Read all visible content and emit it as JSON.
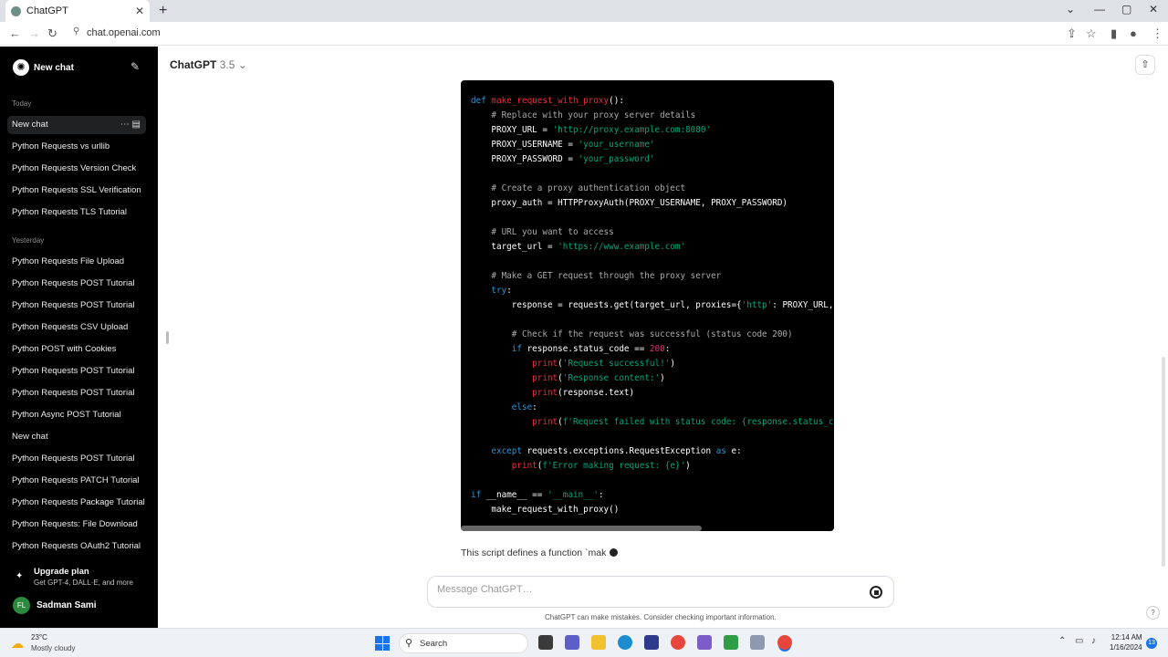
{
  "browser": {
    "tab_title": "ChatGPT",
    "url": "chat.openai.com"
  },
  "sidebar": {
    "new_chat_label": "New chat",
    "sections": [
      {
        "heading": "Today",
        "items": [
          {
            "label": "New chat",
            "active": true
          },
          {
            "label": "Python Requests vs urllib"
          },
          {
            "label": "Python Requests Version Check"
          },
          {
            "label": "Python Requests SSL Verification"
          },
          {
            "label": "Python Requests TLS Tutorial"
          }
        ]
      },
      {
        "heading": "Yesterday",
        "items": [
          {
            "label": "Python Requests File Upload"
          },
          {
            "label": "Python Requests POST Tutorial"
          },
          {
            "label": "Python Requests POST Tutorial"
          },
          {
            "label": "Python Requests CSV Upload"
          },
          {
            "label": "Python POST with Cookies"
          },
          {
            "label": "Python Requests POST Tutorial"
          },
          {
            "label": "Python Requests POST Tutorial"
          },
          {
            "label": "Python Async POST Tutorial"
          },
          {
            "label": "New chat"
          },
          {
            "label": "Python Requests POST Tutorial"
          },
          {
            "label": "Python Requests PATCH Tutorial"
          },
          {
            "label": "Python Requests Package Tutorial"
          },
          {
            "label": "Python Requests: File Download"
          },
          {
            "label": "Python Requests OAuth2 Tutorial"
          }
        ]
      }
    ],
    "upgrade": {
      "title": "Upgrade plan",
      "subtitle": "Get GPT-4, DALL·E, and more"
    },
    "user": {
      "initials": "FL",
      "name": "Sadman Sami"
    }
  },
  "header": {
    "model": "ChatGPT",
    "version": "3.5"
  },
  "code_lines": [
    [
      {
        "t": "def ",
        "c": "kw"
      },
      {
        "t": "make_request_with_proxy",
        "c": "fn"
      },
      {
        "t": "():"
      }
    ],
    [
      {
        "t": "    "
      },
      {
        "t": "# Replace with your proxy server details",
        "c": "cm"
      }
    ],
    [
      {
        "t": "    PROXY_URL = "
      },
      {
        "t": "'http://proxy.example.com:8080'",
        "c": "str"
      }
    ],
    [
      {
        "t": "    PROXY_USERNAME = "
      },
      {
        "t": "'your_username'",
        "c": "str"
      }
    ],
    [
      {
        "t": "    PROXY_PASSWORD = "
      },
      {
        "t": "'your_password'",
        "c": "str"
      }
    ],
    [],
    [
      {
        "t": "    "
      },
      {
        "t": "# Create a proxy authentication object",
        "c": "cm"
      }
    ],
    [
      {
        "t": "    proxy_auth = HTTPProxyAuth(PROXY_USERNAME, PROXY_PASSWORD)"
      }
    ],
    [],
    [
      {
        "t": "    "
      },
      {
        "t": "# URL you want to access",
        "c": "cm"
      }
    ],
    [
      {
        "t": "    target_url = "
      },
      {
        "t": "'https://www.example.com'",
        "c": "str"
      }
    ],
    [],
    [
      {
        "t": "    "
      },
      {
        "t": "# Make a GET request through the proxy server",
        "c": "cm"
      }
    ],
    [
      {
        "t": "    "
      },
      {
        "t": "try",
        "c": "kw"
      },
      {
        "t": ":"
      }
    ],
    [
      {
        "t": "        response = requests.get(target_url, proxies={"
      },
      {
        "t": "'http'",
        "c": "str"
      },
      {
        "t": ": PROXY_URL,"
      }
    ],
    [],
    [
      {
        "t": "        "
      },
      {
        "t": "# Check if the request was successful (status code 200)",
        "c": "cm"
      }
    ],
    [
      {
        "t": "        "
      },
      {
        "t": "if",
        "c": "kw"
      },
      {
        "t": " response.status_code == "
      },
      {
        "t": "200",
        "c": "num"
      },
      {
        "t": ":"
      }
    ],
    [
      {
        "t": "            "
      },
      {
        "t": "print",
        "c": "fn"
      },
      {
        "t": "("
      },
      {
        "t": "'Request successful!'",
        "c": "str"
      },
      {
        "t": ")"
      }
    ],
    [
      {
        "t": "            "
      },
      {
        "t": "print",
        "c": "fn"
      },
      {
        "t": "("
      },
      {
        "t": "'Response content:'",
        "c": "str"
      },
      {
        "t": ")"
      }
    ],
    [
      {
        "t": "            "
      },
      {
        "t": "print",
        "c": "fn"
      },
      {
        "t": "(response.text)"
      }
    ],
    [
      {
        "t": "        "
      },
      {
        "t": "else",
        "c": "kw"
      },
      {
        "t": ":"
      }
    ],
    [
      {
        "t": "            "
      },
      {
        "t": "print",
        "c": "fn"
      },
      {
        "t": "("
      },
      {
        "t": "f'Request failed with status code: {response.status_c",
        "c": "str"
      }
    ],
    [],
    [
      {
        "t": "    "
      },
      {
        "t": "except",
        "c": "kw"
      },
      {
        "t": " requests.exceptions.RequestException "
      },
      {
        "t": "as",
        "c": "kw"
      },
      {
        "t": " e:"
      }
    ],
    [
      {
        "t": "        "
      },
      {
        "t": "print",
        "c": "fn"
      },
      {
        "t": "("
      },
      {
        "t": "f'Error making request: {e}'",
        "c": "str"
      },
      {
        "t": ")"
      }
    ],
    [],
    [
      {
        "t": "if",
        "c": "kw"
      },
      {
        "t": " __name__ == "
      },
      {
        "t": "'__main__'",
        "c": "str"
      },
      {
        "t": ":"
      }
    ],
    [
      {
        "t": "    make_request_with_proxy()"
      }
    ]
  ],
  "answer_text": "This script defines a function `mak",
  "composer": {
    "placeholder": "Message ChatGPT…"
  },
  "disclaimer": "ChatGPT can make mistakes. Consider checking important information.",
  "taskbar": {
    "temp": "23°C",
    "condition": "Mostly cloudy",
    "search_label": "Search",
    "time": "12:14 AM",
    "date": "1/16/2024",
    "notifications": "13"
  }
}
